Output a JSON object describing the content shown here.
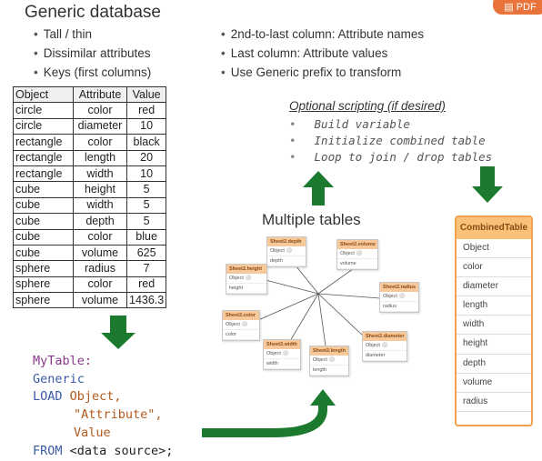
{
  "title": "Generic database",
  "badge": "PDF",
  "left_bullets": [
    "Tall / thin",
    "Dissimilar attributes",
    "Keys (first columns)"
  ],
  "right_bullets": [
    "2nd-to-last column: Attribute names",
    "Last column: Attribute values",
    "Use Generic prefix to transform"
  ],
  "table": {
    "headers": [
      "Object",
      "Attribute",
      "Value"
    ],
    "rows": [
      [
        "circle",
        "color",
        "red"
      ],
      [
        "circle",
        "diameter",
        "10"
      ],
      [
        "rectangle",
        "color",
        "black"
      ],
      [
        "rectangle",
        "length",
        "20"
      ],
      [
        "rectangle",
        "width",
        "10"
      ],
      [
        "cube",
        "height",
        "5"
      ],
      [
        "cube",
        "width",
        "5"
      ],
      [
        "cube",
        "depth",
        "5"
      ],
      [
        "cube",
        "color",
        "blue"
      ],
      [
        "cube",
        "volume",
        "625"
      ],
      [
        "sphere",
        "radius",
        "7"
      ],
      [
        "sphere",
        "color",
        "red"
      ],
      [
        "sphere",
        "volume",
        "1436.3"
      ]
    ]
  },
  "optional": {
    "title": "Optional scripting (if desired)",
    "items": [
      "Build variable",
      "Initialize combined table",
      "Loop to join / drop tables"
    ]
  },
  "multiple_tables_title": "Multiple tables",
  "sheets": [
    {
      "name": "Sheet2.depth",
      "fields": [
        "Object",
        "depth"
      ]
    },
    {
      "name": "Sheet2.volume",
      "fields": [
        "Object",
        "volume"
      ]
    },
    {
      "name": "Sheet2.height",
      "fields": [
        "Object",
        "height"
      ]
    },
    {
      "name": "Sheet2.radius",
      "fields": [
        "Object",
        "radius"
      ]
    },
    {
      "name": "Sheet2.color",
      "fields": [
        "Object",
        "color"
      ]
    },
    {
      "name": "Sheet2.diameter",
      "fields": [
        "Object",
        "diameter"
      ]
    },
    {
      "name": "Sheet2.width",
      "fields": [
        "Object",
        "width"
      ]
    },
    {
      "name": "Sheet2.length",
      "fields": [
        "Object",
        "length"
      ]
    }
  ],
  "combined": {
    "title": "CombinedTable",
    "fields": [
      "Object",
      "color",
      "diameter",
      "length",
      "width",
      "height",
      "depth",
      "volume",
      "radius"
    ]
  },
  "code": {
    "line1": "MyTable:",
    "line2": "Generic",
    "line3_kw": "LOAD",
    "line3_rest": " Object,",
    "line4": "\"Attribute\",",
    "line5": "Value",
    "line6_kw": "FROM",
    "line6_rest": " <data source>;"
  },
  "colors": {
    "arrow": "#1b7a2e",
    "accent": "#f2a24f",
    "badge": "#e8743b"
  }
}
